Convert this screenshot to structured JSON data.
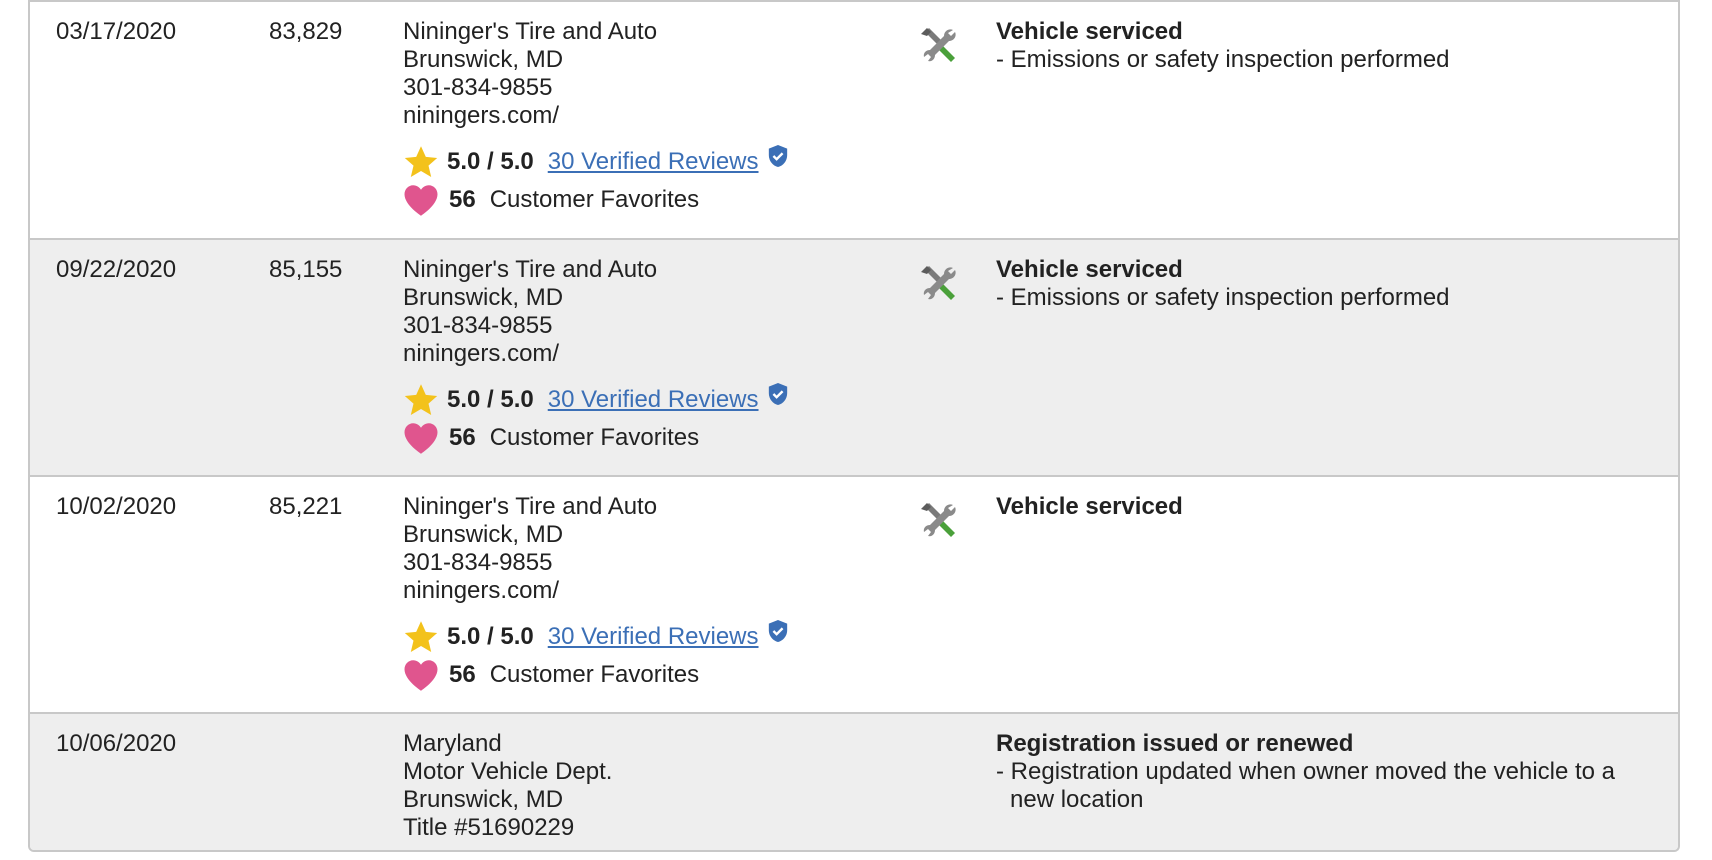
{
  "colors": {
    "link": "#3b6fb6",
    "star": "#f3c21b",
    "heart": "#e0558e",
    "shield": "#3b6fb6",
    "wrench": "#7a7a7a",
    "screwdriver": "#4aa03a"
  },
  "records": [
    {
      "date": "03/17/2020",
      "mileage": "83,829",
      "source": [
        "Nininger's Tire and Auto",
        "Brunswick, MD",
        "301-834-9855",
        "niningers.com/"
      ],
      "rating": {
        "score": "5.0 / 5.0",
        "reviews": "30 Verified Reviews"
      },
      "favorites": {
        "count": "56",
        "label": "Customer Favorites"
      },
      "icon": "wrench-screwdriver-icon",
      "details": {
        "title": "Vehicle serviced",
        "items": [
          "- Emissions or safety inspection performed"
        ]
      }
    },
    {
      "date": "09/22/2020",
      "mileage": "85,155",
      "source": [
        "Nininger's Tire and Auto",
        "Brunswick, MD",
        "301-834-9855",
        "niningers.com/"
      ],
      "rating": {
        "score": "5.0 / 5.0",
        "reviews": "30 Verified Reviews"
      },
      "favorites": {
        "count": "56",
        "label": "Customer Favorites"
      },
      "icon": "wrench-screwdriver-icon",
      "details": {
        "title": "Vehicle serviced",
        "items": [
          "- Emissions or safety inspection performed"
        ]
      }
    },
    {
      "date": "10/02/2020",
      "mileage": "85,221",
      "source": [
        "Nininger's Tire and Auto",
        "Brunswick, MD",
        "301-834-9855",
        "niningers.com/"
      ],
      "rating": {
        "score": "5.0 / 5.0",
        "reviews": "30 Verified Reviews"
      },
      "favorites": {
        "count": "56",
        "label": "Customer Favorites"
      },
      "icon": "wrench-screwdriver-icon",
      "details": {
        "title": "Vehicle serviced",
        "items": []
      }
    },
    {
      "date": "10/06/2020",
      "mileage": "",
      "source": [
        "Maryland",
        "Motor Vehicle Dept.",
        "Brunswick, MD",
        "Title #51690229"
      ],
      "details": {
        "title": "Registration issued or renewed",
        "items": [
          "- Registration updated when owner moved the vehicle to a new location"
        ]
      }
    }
  ]
}
